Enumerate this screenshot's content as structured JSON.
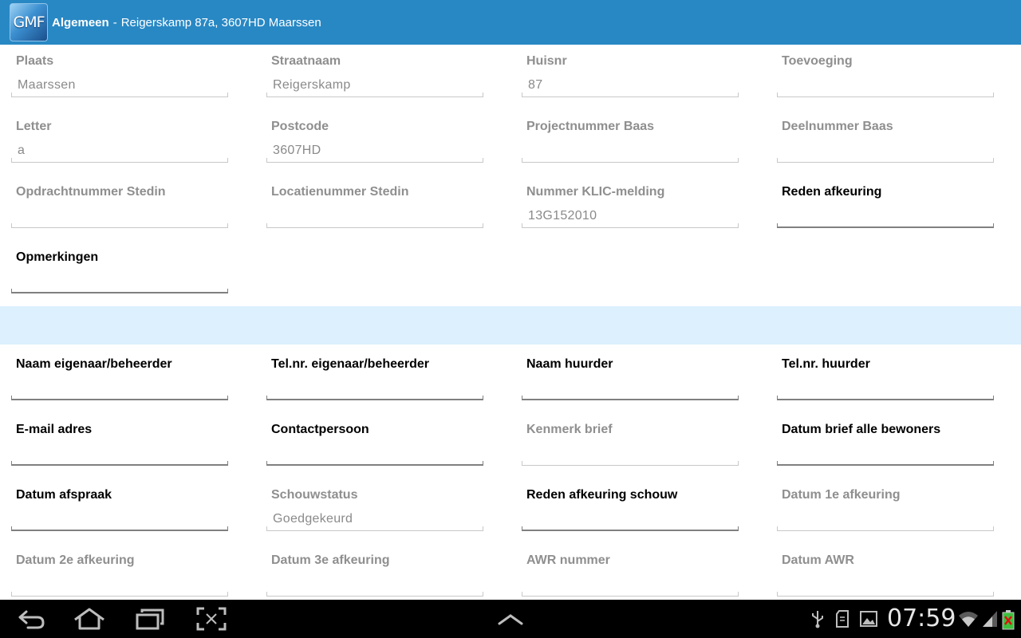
{
  "actionbar": {
    "logo_text": "GMF",
    "title": "Algemeen",
    "separator": "-",
    "subtitle": "Reigerskamp 87a, 3607HD Maarssen"
  },
  "fields": [
    {
      "label": "Plaats",
      "value": "Maarssen",
      "state": "disabled"
    },
    {
      "label": "Straatnaam",
      "value": "Reigerskamp",
      "state": "disabled"
    },
    {
      "label": "Huisnr",
      "value": "87",
      "state": "disabled"
    },
    {
      "label": "Toevoeging",
      "value": "",
      "state": "disabled"
    },
    {
      "label": "Letter",
      "value": "a",
      "state": "disabled"
    },
    {
      "label": "Postcode",
      "value": "3607HD",
      "state": "disabled"
    },
    {
      "label": "Projectnummer Baas",
      "value": "",
      "state": "disabled"
    },
    {
      "label": "Deelnummer Baas",
      "value": "",
      "state": "disabled"
    },
    {
      "label": "Opdrachtnummer Stedin",
      "value": "",
      "state": "disabled"
    },
    {
      "label": "Locatienummer Stedin",
      "value": "",
      "state": "disabled"
    },
    {
      "label": "Nummer KLIC-melding",
      "value": "13G152010",
      "state": "disabled"
    },
    {
      "label": "Reden afkeuring",
      "value": "",
      "state": "active"
    },
    {
      "label": "Opmerkingen",
      "value": "",
      "state": "active"
    },
    {
      "label": "Naam eigenaar/beheerder",
      "value": "",
      "state": "active"
    },
    {
      "label": "Tel.nr. eigenaar/beheerder",
      "value": "",
      "state": "active"
    },
    {
      "label": "Naam huurder",
      "value": "",
      "state": "active"
    },
    {
      "label": "Tel.nr. huurder",
      "value": "",
      "state": "active"
    },
    {
      "label": "E-mail adres",
      "value": "",
      "state": "active"
    },
    {
      "label": "Contactpersoon",
      "value": "",
      "state": "active"
    },
    {
      "label": "Kenmerk brief",
      "value": "",
      "state": "disabled"
    },
    {
      "label": "Datum brief alle bewoners",
      "value": "",
      "state": "active"
    },
    {
      "label": "Datum afspraak",
      "value": "",
      "state": "active"
    },
    {
      "label": "Schouwstatus",
      "value": "Goedgekeurd",
      "state": "disabled"
    },
    {
      "label": "Reden afkeuring schouw",
      "value": "",
      "state": "active"
    },
    {
      "label": "Datum 1e afkeuring",
      "value": "",
      "state": "disabled"
    },
    {
      "label": "Datum 2e afkeuring",
      "value": "",
      "state": "disabled"
    },
    {
      "label": "Datum 3e afkeuring",
      "value": "",
      "state": "disabled"
    },
    {
      "label": "AWR nummer",
      "value": "",
      "state": "disabled"
    },
    {
      "label": "Datum AWR",
      "value": "",
      "state": "disabled"
    }
  ],
  "system_bar": {
    "clock": "07:59",
    "nav_icons": [
      "back-icon",
      "home-icon",
      "recent-apps-icon",
      "screenshot-icon",
      "menu-up-icon"
    ],
    "status_icons": [
      "usb-icon",
      "sd-card-icon",
      "gallery-icon",
      "wifi-icon",
      "signal-icon",
      "battery-icon"
    ]
  },
  "colors": {
    "actionbar": "#2888c4",
    "section_band": "#dcf0fe",
    "disabled_label": "#8f8f8f",
    "active_label": "#000000"
  }
}
